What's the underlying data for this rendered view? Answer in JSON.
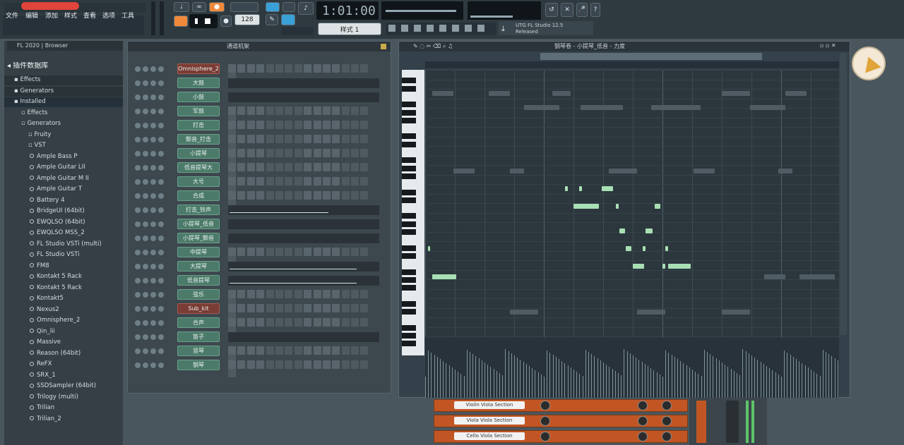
{
  "menu": [
    "文件",
    "编辑",
    "添加",
    "样式",
    "查看",
    "选项",
    "工具"
  ],
  "transport": {
    "time": "1:01:00",
    "tempo": "128",
    "pattern": "样式 1",
    "hint_title": "UTG FL Studio 12.5",
    "hint_sub": "Released"
  },
  "browser": {
    "header": "FL 2020 | Browser",
    "section": "插件数据库",
    "items": [
      {
        "label": "Effects",
        "kind": "folder"
      },
      {
        "label": "Generators",
        "kind": "folder"
      },
      {
        "label": "Installed",
        "kind": "folder"
      },
      {
        "label": "Effects",
        "kind": "sub"
      },
      {
        "label": "Generators",
        "kind": "sub"
      },
      {
        "label": "Fruity",
        "kind": "leaf"
      },
      {
        "label": "VST",
        "kind": "leaf"
      },
      {
        "label": "Ample Bass P",
        "kind": "dot"
      },
      {
        "label": "Ample Guitar LII",
        "kind": "dot"
      },
      {
        "label": "Ample Guitar M II",
        "kind": "dot"
      },
      {
        "label": "Ample Guitar T",
        "kind": "dot"
      },
      {
        "label": "Battery 4",
        "kind": "dot"
      },
      {
        "label": "BridgeUI (64bit)",
        "kind": "dot"
      },
      {
        "label": "EWQLSO (64bit)",
        "kind": "dot"
      },
      {
        "label": "EWQLSO MSS_2",
        "kind": "dot"
      },
      {
        "label": "FL Studio VSTi (multi)",
        "kind": "dot"
      },
      {
        "label": "FL Studio VSTi",
        "kind": "dot"
      },
      {
        "label": "FM8",
        "kind": "dot"
      },
      {
        "label": "Kontakt 5 Rack",
        "kind": "dot"
      },
      {
        "label": "Kontakt 5 Rack",
        "kind": "dot"
      },
      {
        "label": "Kontakt5",
        "kind": "dot"
      },
      {
        "label": "Nexus2",
        "kind": "dot"
      },
      {
        "label": "Omnisphere_2",
        "kind": "dot"
      },
      {
        "label": "Qin_lii",
        "kind": "dot"
      },
      {
        "label": "Massive",
        "kind": "dot"
      },
      {
        "label": "Reason (64bit)",
        "kind": "dot"
      },
      {
        "label": "ReFX",
        "kind": "dot"
      },
      {
        "label": "SRX_1",
        "kind": "dot"
      },
      {
        "label": "SSDSampler (64bit)",
        "kind": "dot"
      },
      {
        "label": "Trilogy (multi)",
        "kind": "dot"
      },
      {
        "label": "Trilian",
        "kind": "dot"
      },
      {
        "label": "Trilian_2",
        "kind": "dot"
      }
    ]
  },
  "rack": {
    "title": "通道机架",
    "channels": [
      "Omnisphere_2",
      "大鼓",
      "小鼓",
      "军鼓",
      "打击",
      "颤音_打击",
      "小提琴",
      "低音提琴大",
      "大号",
      "合成",
      "打击_铃声",
      "小提琴_低音",
      "小提琴_颤音",
      "中提琴",
      "大提琴",
      "低音提琴",
      "弦乐",
      "Sub_kit",
      "合声",
      "笛子",
      "竖琴",
      "钢琴"
    ]
  },
  "pianoroll": {
    "title": "钢琴卷 - 小提琴_低音 - 力度"
  },
  "mixer_strips": [
    "Violin Viola Section",
    "Viola Viola Section",
    "Cello Viola Section"
  ]
}
